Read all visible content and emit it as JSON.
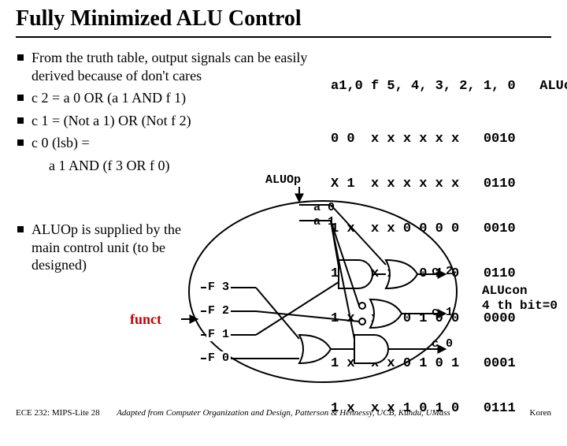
{
  "title": "Fully Minimized ALU Control",
  "bullets": [
    "From the truth table, output signals can be easily derived because of don't cares",
    "c 2 = a 0 OR (a 1 AND f 1)",
    "c 1 =  (Not a 1) OR (Not f 2)",
    "c 0 (lsb) ="
  ],
  "bullet_tail": "a 1 AND (f 3 OR f 0)",
  "bullets2": [
    "ALUOp is supplied by the main control unit (to be designed)"
  ],
  "funct_label": "funct",
  "aluop": "ALUOp",
  "a0": "a 0",
  "a1": "a 1",
  "f3": "F 3",
  "f2": "F 2",
  "f1": "F 1",
  "f0": "F 0",
  "c2": "c 2",
  "c1": "c 1",
  "c0": "c 0",
  "side1": "ALUcon",
  "side2": "4 th bit=0",
  "table": {
    "h1": "a1,0",
    "h2": "f 5, 4, 3, 2, 1, 0",
    "h3": "ALUcon",
    "rows": [
      {
        "a": "0 0",
        "f": "x x x x x x",
        "c": "0010"
      },
      {
        "a": "X 1",
        "f": "x x x x x x",
        "c": "0110"
      },
      {
        "a": "1 x",
        "f": "x x 0 0 0 0",
        "c": "0010"
      },
      {
        "a": "1 x",
        "f": "x x 0 0 1 0",
        "c": "0110"
      },
      {
        "a": "1 x",
        "f": "x x 0 1 0 0",
        "c": "0000"
      },
      {
        "a": "1 x",
        "f": "x x 0 1 0 1",
        "c": "0001"
      },
      {
        "a": "1 x",
        "f": "x x 1 0 1 0",
        "c": "0111"
      }
    ]
  },
  "footer": {
    "left": "ECE 232: MIPS-Lite 28",
    "center": "Adapted from Computer Organization and Design, Patterson & Hennessy, UCB, Kundu, UMass",
    "right": "Koren"
  }
}
